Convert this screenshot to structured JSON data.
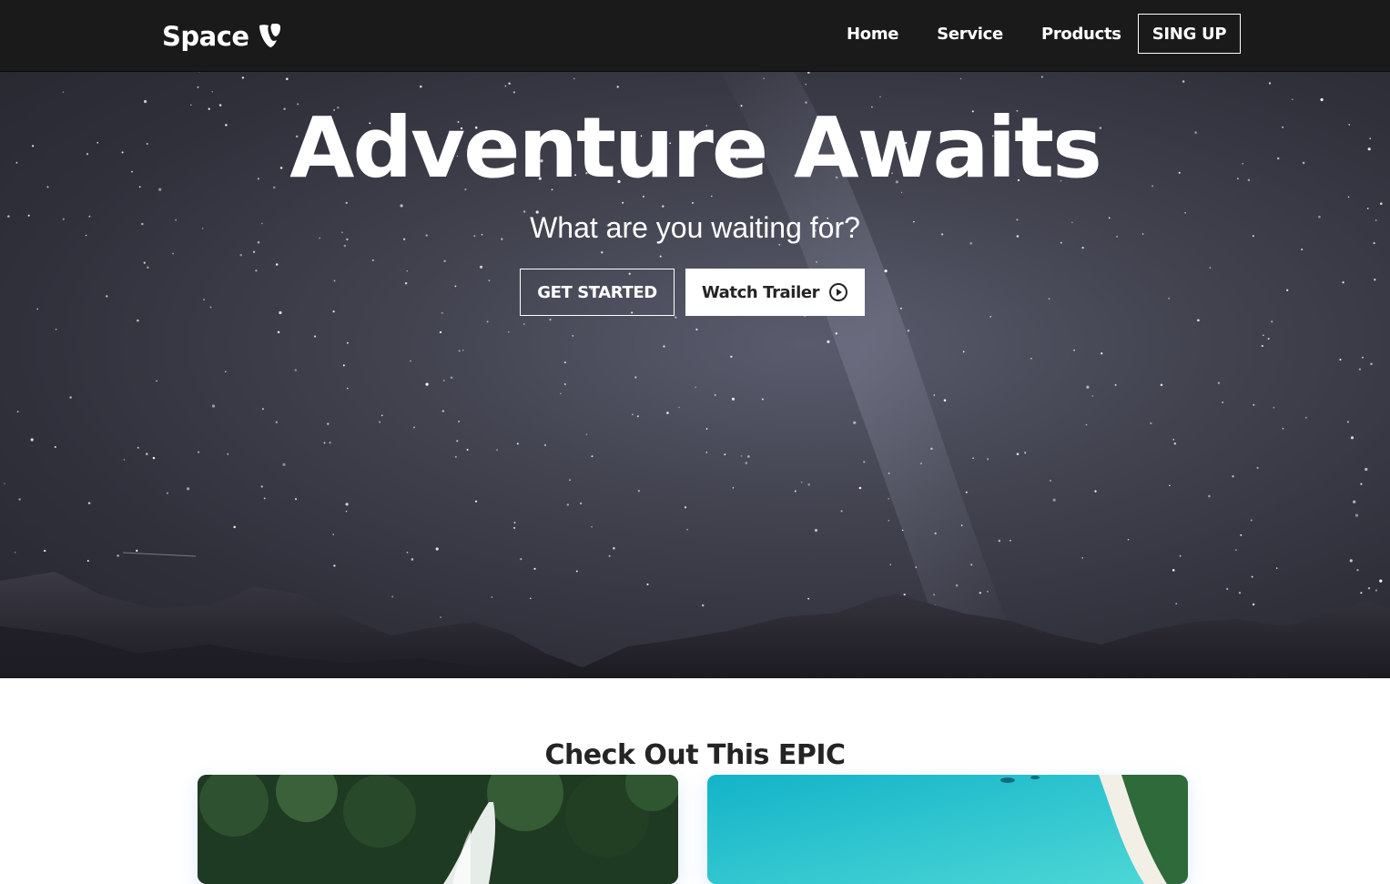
{
  "navbar": {
    "logo_text": "Space",
    "logo_icon": "typo3-logo-icon",
    "links": [
      {
        "label": "Home"
      },
      {
        "label": "Service"
      },
      {
        "label": "Products"
      }
    ],
    "signup_label": "SING UP"
  },
  "hero": {
    "title": "Adventure Awaits",
    "subtitle": "What are you waiting for?",
    "primary_button": "GET STARTED",
    "secondary_button": "Watch Trailer",
    "secondary_button_icon": "play-circle-icon"
  },
  "section": {
    "title": "Check Out This EPIC"
  },
  "colors": {
    "navbar_bg": "#1a1a1a",
    "hero_text": "#ffffff",
    "button_light_bg": "#ffffff",
    "dark_text": "#242424"
  }
}
